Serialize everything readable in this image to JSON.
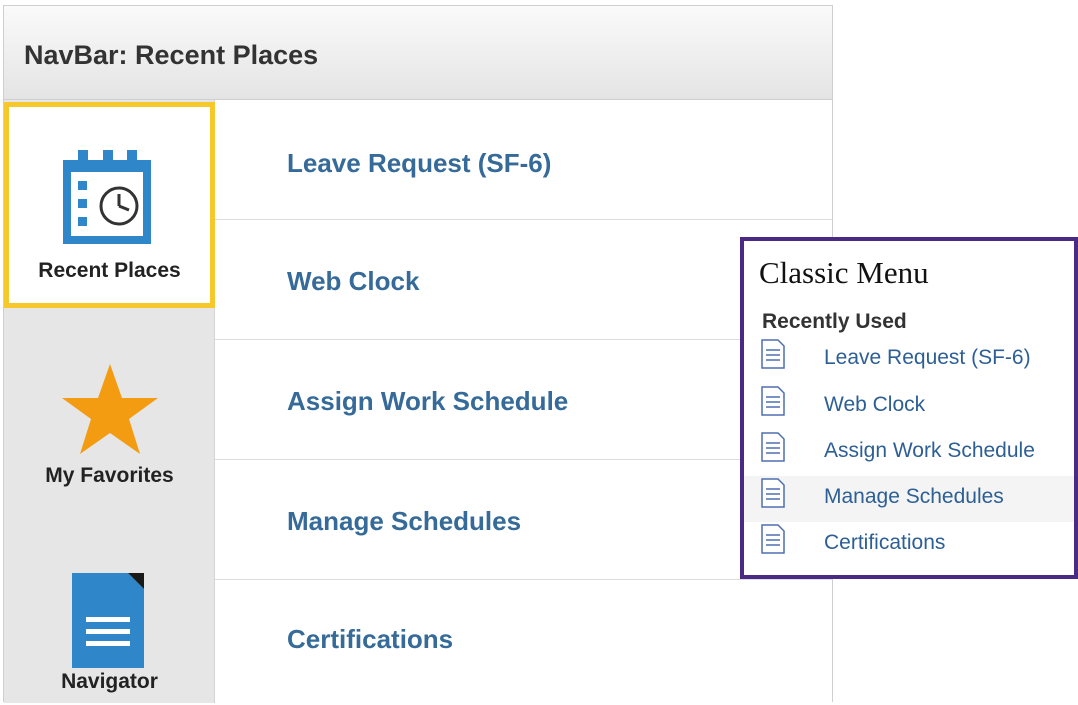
{
  "navbar": {
    "title": "NavBar: Recent Places",
    "tiles": [
      {
        "label": "Recent Places",
        "icon": "calendar-clock-icon",
        "selected": true
      },
      {
        "label": "My Favorites",
        "icon": "star-icon"
      },
      {
        "label": "Navigator",
        "icon": "document-icon"
      }
    ],
    "items": [
      {
        "label": "Leave Request (SF-6)"
      },
      {
        "label": "Web Clock"
      },
      {
        "label": "Assign Work Schedule"
      },
      {
        "label": "Manage Schedules"
      },
      {
        "label": "Certifications"
      }
    ]
  },
  "classic_menu": {
    "title": "Classic Menu",
    "section": "Recently Used",
    "items": [
      {
        "label": "Leave Request (SF-6)"
      },
      {
        "label": "Web Clock"
      },
      {
        "label": "Assign Work Schedule"
      },
      {
        "label": "Manage Schedules",
        "hovered": true
      },
      {
        "label": "Certifications"
      }
    ]
  },
  "colors": {
    "selected_border": "#f7c82c",
    "link": "#356a99",
    "classic_border": "#4b2a86",
    "icon_blue": "#2f86c8",
    "star": "#f39c12"
  }
}
